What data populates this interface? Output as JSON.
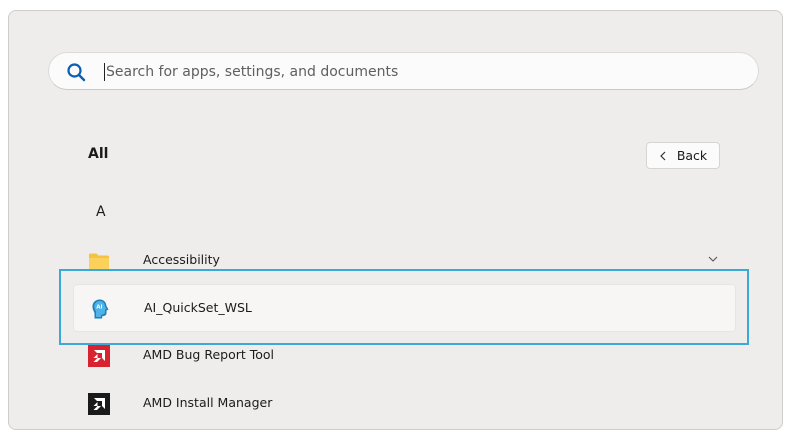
{
  "search": {
    "placeholder": "Search for apps, settings, and documents",
    "value": ""
  },
  "section": {
    "title": "All",
    "back_label": "Back"
  },
  "groups": [
    {
      "letter": "A",
      "items": [
        {
          "label": "Accessibility",
          "icon": "folder-icon",
          "expandable": true
        },
        {
          "label": "AI_QuickSet_WSL",
          "icon": "ai-quickset-app-icon"
        },
        {
          "label": "AMD Bug Report Tool",
          "icon": "amd-bug-report-icon"
        },
        {
          "label": "AMD Install Manager",
          "icon": "amd-install-manager-icon"
        }
      ]
    }
  ],
  "colors": {
    "accent": "#3aa9d8",
    "search_icon": "#0a5fb4",
    "amd_red": "#d8222f",
    "amd_black": "#1a1a1a",
    "folder": "#f6c244"
  }
}
